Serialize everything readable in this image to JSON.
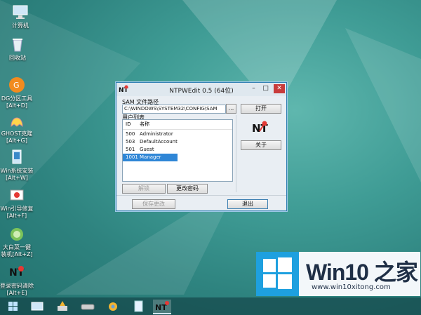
{
  "desktop": {
    "icons": [
      {
        "label": "计算机"
      },
      {
        "label": "回收站"
      },
      {
        "label": "DG分区工具"
      },
      {
        "label": "[Alt+D]"
      },
      {
        "label": "GHOST克隆"
      },
      {
        "label": "[Alt+G]"
      },
      {
        "label": "Win系统安装"
      },
      {
        "label": "[Alt+W]"
      },
      {
        "label": "Win引导修复"
      },
      {
        "label": "[Alt+F]"
      },
      {
        "label": "大白菜一键"
      },
      {
        "label": "装机[Alt+Z]"
      },
      {
        "label": "登录密码清除"
      },
      {
        "label": "[Alt+E]"
      }
    ]
  },
  "window": {
    "title": "NTPWEdit 0.5 (64位)",
    "sam_label": "SAM 文件路径",
    "sam_path": "C:\\WINDOWS\\SYSTEM32\\CONFIG\\SAM",
    "browse_label": "...",
    "open_label": "打开",
    "user_list_label": "用户列表",
    "col_id": "ID",
    "col_name": "名称",
    "users": [
      {
        "id": "500",
        "name": "Administrator"
      },
      {
        "id": "503",
        "name": "DefaultAccount"
      },
      {
        "id": "501",
        "name": "Guest"
      },
      {
        "id": "1001",
        "name": "Manager"
      }
    ],
    "about_label": "关于",
    "unlock_label": "解锁",
    "change_pwd_label": "更改密码",
    "save_label": "保存更改",
    "exit_label": "退出"
  },
  "brand": {
    "text": "Win10 之家",
    "url": "www.win10xitong.com"
  },
  "colors": {
    "accent": "#2f86d6",
    "close": "#c83b3b",
    "brand_blue": "#1ea0df"
  }
}
